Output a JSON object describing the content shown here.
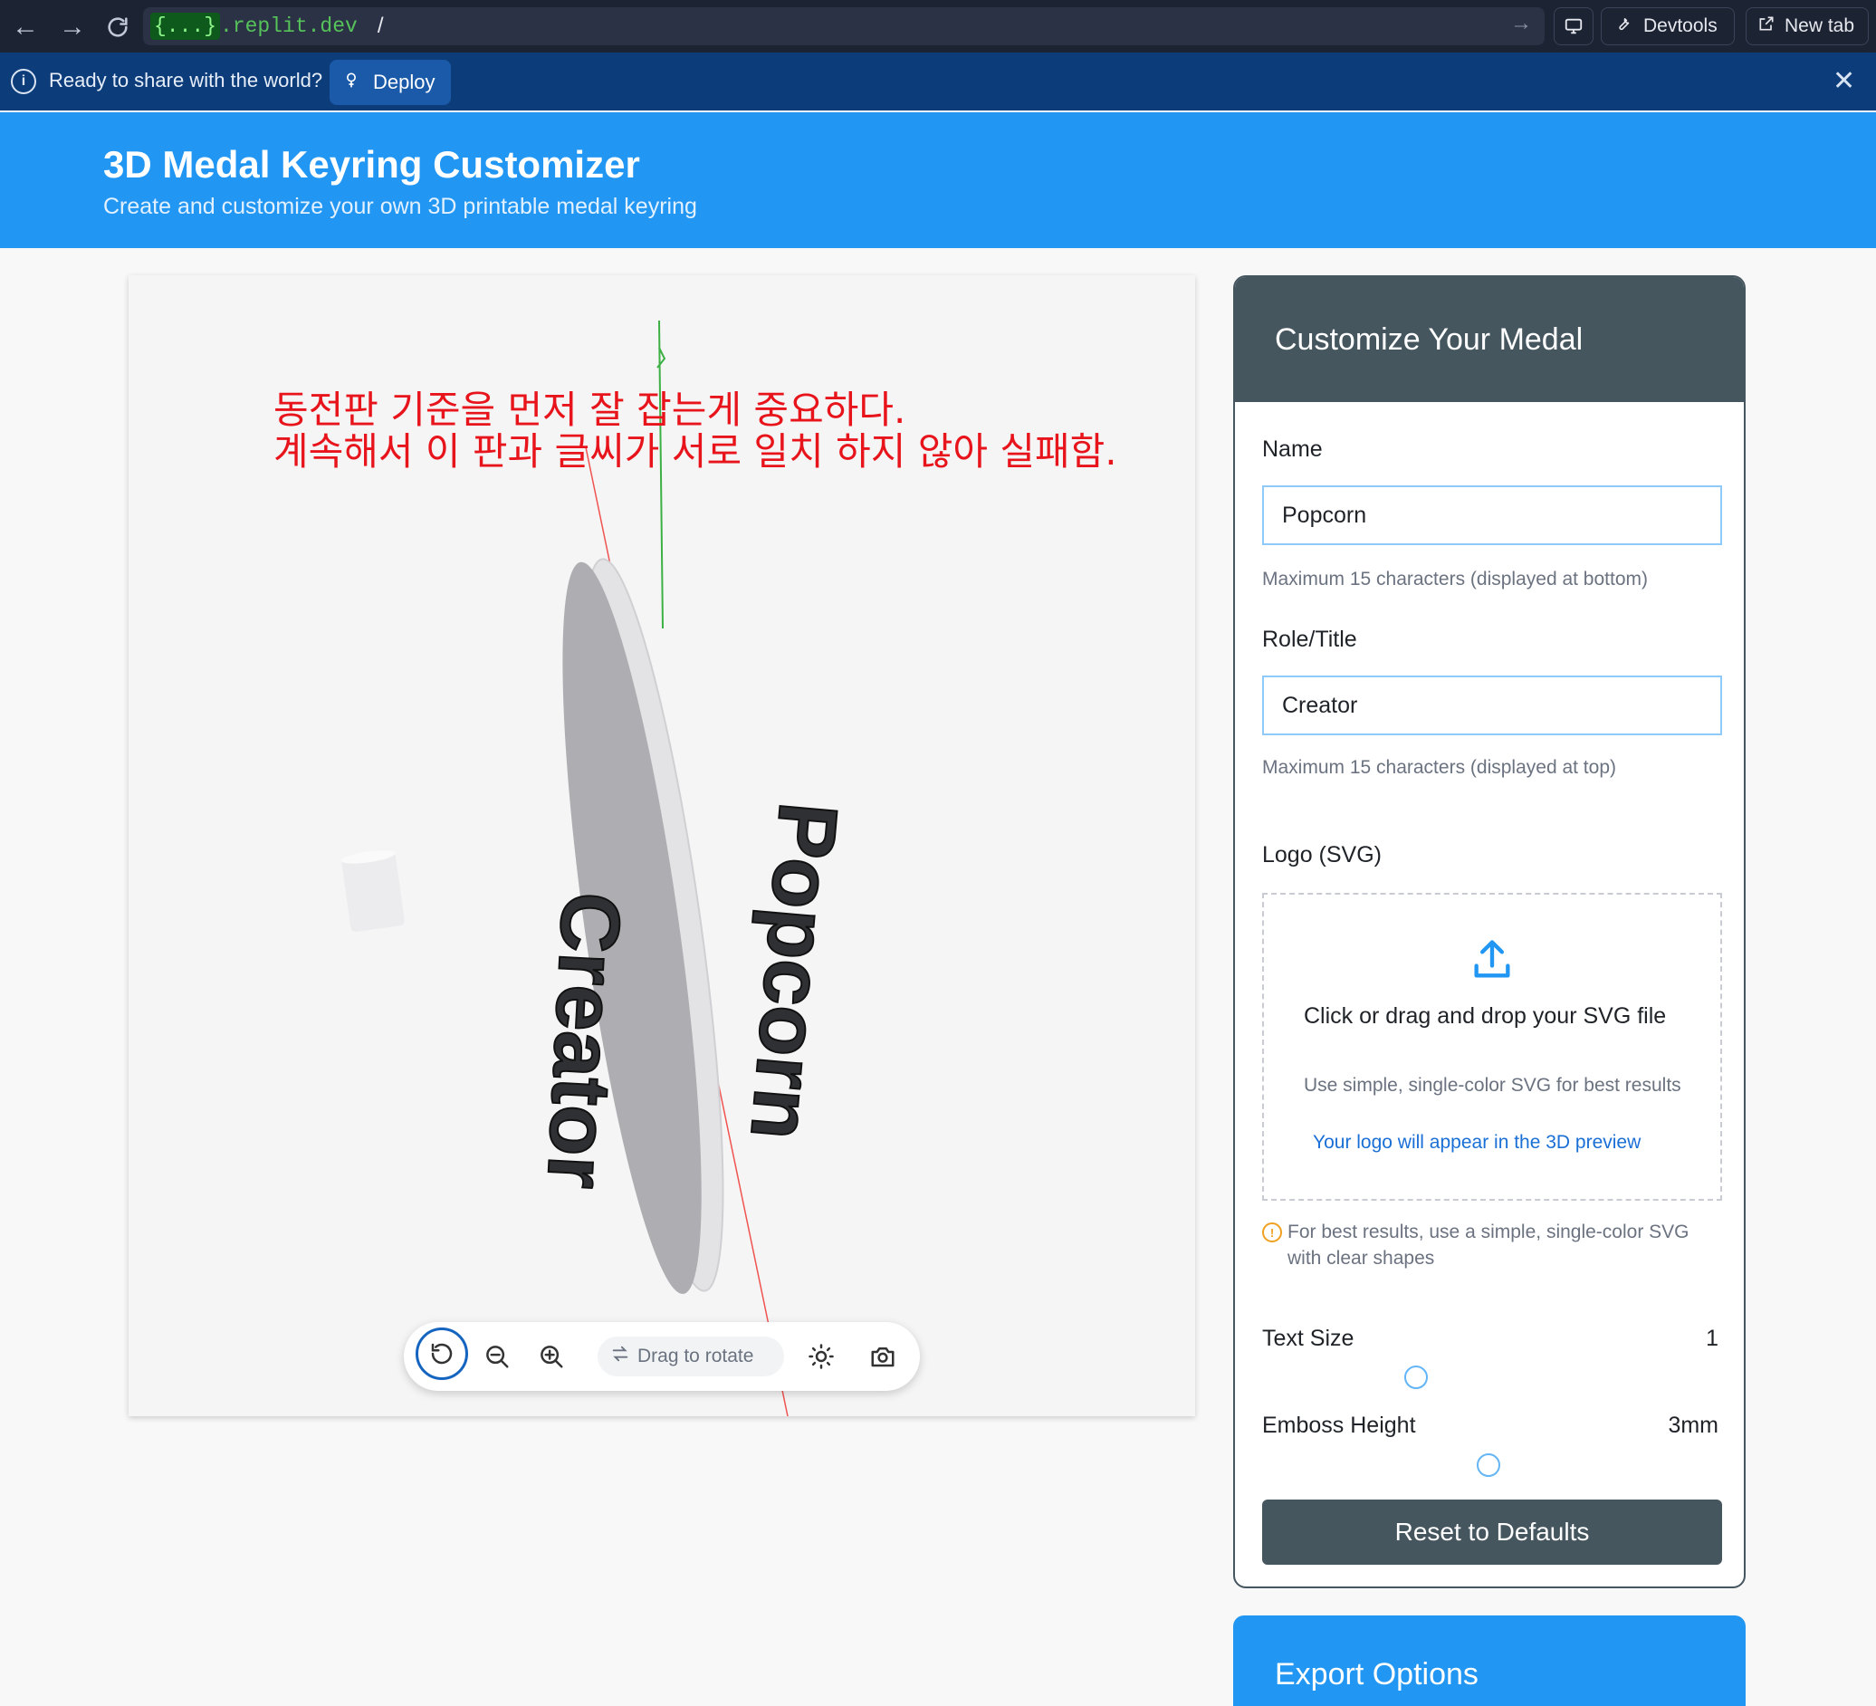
{
  "browser": {
    "url_host_prefix": "{...}",
    "url_host": ".replit.dev",
    "url_path": "/",
    "devtools_label": "Devtools",
    "new_tab_label": "New tab"
  },
  "banner": {
    "message": "Ready to share with the world?",
    "deploy_label": "Deploy"
  },
  "header": {
    "title": "3D Medal Keyring Customizer",
    "subtitle": "Create and customize your own 3D printable medal keyring"
  },
  "viewer": {
    "annotation_line1": "동전판 기준을 먼저 잘 잡는게 중요하다.",
    "annotation_line2": "계속해서 이 판과 글씨가 서로 일치 하지 않아 실패함.",
    "medal_top_text": "Creator",
    "medal_bottom_text": "Popcorn",
    "toolbar": {
      "drag_label": "Drag to rotate"
    }
  },
  "panel": {
    "title": "Customize Your Medal",
    "name_label": "Name",
    "name_value": "Popcorn",
    "name_help": "Maximum 15 characters (displayed at bottom)",
    "role_label": "Role/Title",
    "role_value": "Creator",
    "role_help": "Maximum 15 characters (displayed at top)",
    "logo_label": "Logo (SVG)",
    "drop_title": "Click or drag and drop your SVG file",
    "drop_sub": "Use simple, single-color SVG for best results",
    "drop_link": "Your logo will appear in the 3D preview",
    "logo_tip": "For best results, use a simple, single-color SVG with clear shapes",
    "text_size_label": "Text Size",
    "text_size_value": "1",
    "emboss_label": "Emboss Height",
    "emboss_value": "3mm",
    "reset_label": "Reset to Defaults"
  },
  "export": {
    "title": "Export Options"
  }
}
